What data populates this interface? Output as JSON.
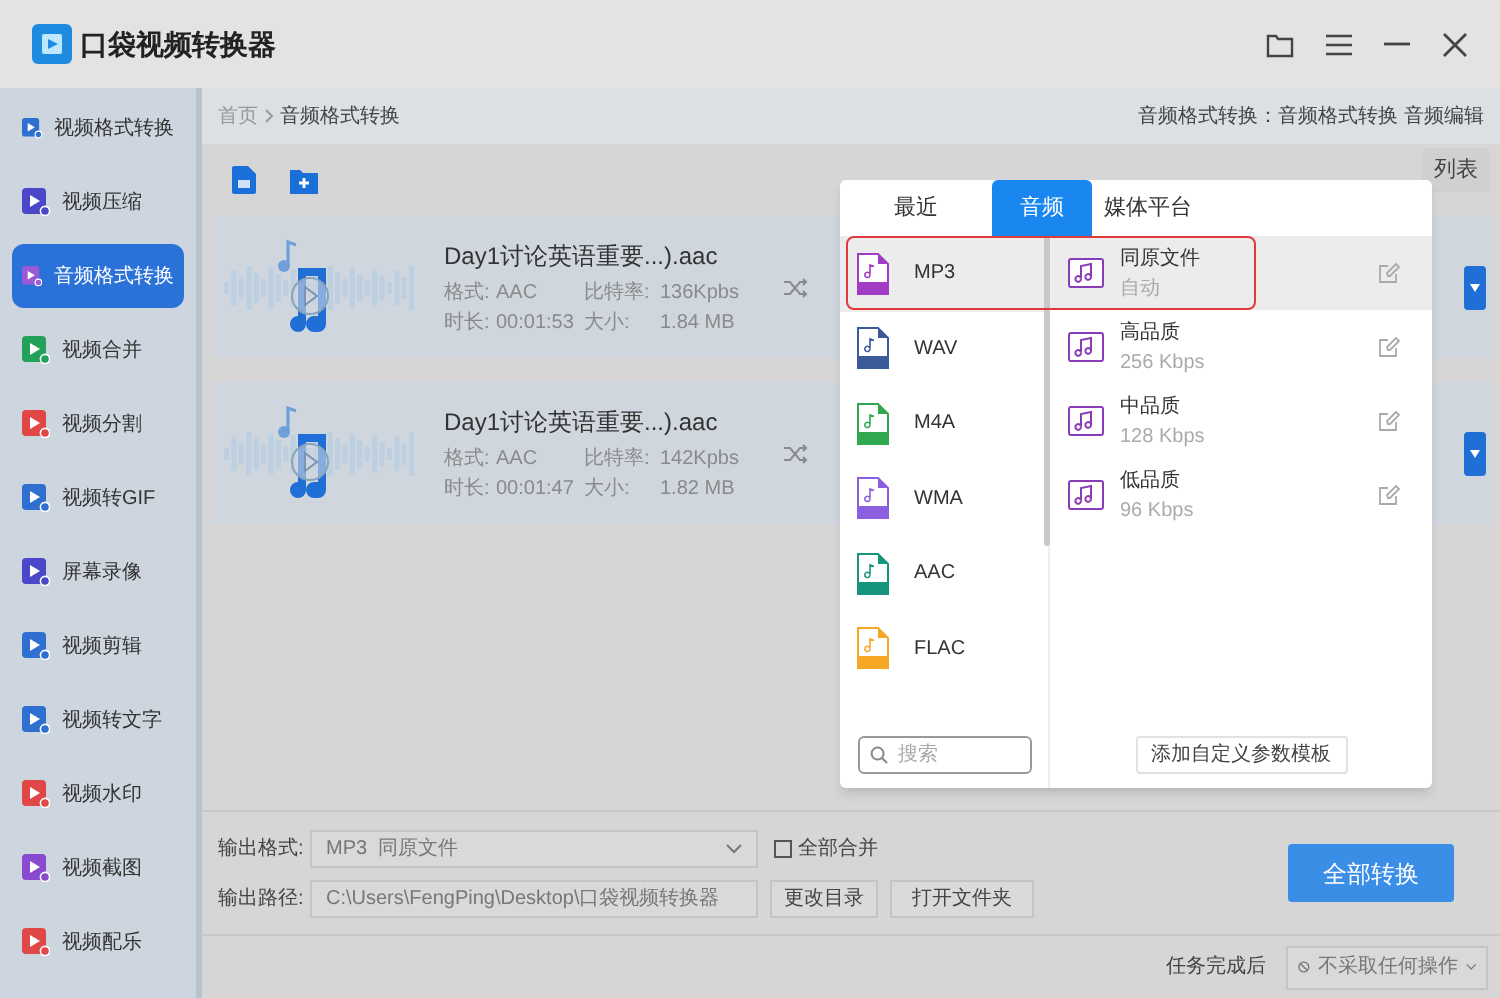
{
  "app": {
    "title": "口袋视频转换器"
  },
  "sidebar": {
    "items": [
      {
        "label": "视频格式转换",
        "color": "#2f6fd0",
        "selected": false
      },
      {
        "label": "视频压缩",
        "color": "#4a48c8",
        "selected": false
      },
      {
        "label": "音频格式转换",
        "color": "#9a5ad8",
        "selected": true
      },
      {
        "label": "视频合并",
        "color": "#23a05a",
        "selected": false
      },
      {
        "label": "视频分割",
        "color": "#e04848",
        "selected": false
      },
      {
        "label": "视频转GIF",
        "color": "#2f6fd0",
        "selected": false
      },
      {
        "label": "屏幕录像",
        "color": "#4a48c8",
        "selected": false
      },
      {
        "label": "视频剪辑",
        "color": "#2f6fd0",
        "selected": false
      },
      {
        "label": "视频转文字",
        "color": "#2f6fd0",
        "selected": false
      },
      {
        "label": "视频水印",
        "color": "#e04848",
        "selected": false
      },
      {
        "label": "视频截图",
        "color": "#8a4ad0",
        "selected": false
      },
      {
        "label": "视频配乐",
        "color": "#e04848",
        "selected": false
      }
    ]
  },
  "breadcrumb": {
    "items": [
      "首页",
      "音频格式转换"
    ],
    "right_text": "音频格式转换：音频格式转换 音频编辑"
  },
  "clear_button": {
    "label": "列表"
  },
  "files": [
    {
      "name": "Day1讨论英语重要...).aac",
      "format_label": "格式:",
      "format": "AAC",
      "bitrate_label": "比特率:",
      "bitrate": "136Kpbs",
      "duration_label": "时长:",
      "duration": "00:01:53",
      "size_label": "大小:",
      "size": "1.84 MB"
    },
    {
      "name": "Day1讨论英语重要...).aac",
      "format_label": "格式:",
      "format": "AAC",
      "bitrate_label": "比特率:",
      "bitrate": "142Kpbs",
      "duration_label": "时长:",
      "duration": "00:01:47",
      "size_label": "大小:",
      "size": "1.82 MB"
    }
  ],
  "format_popup": {
    "tabs": [
      {
        "label": "最近",
        "selected": false
      },
      {
        "label": "音频",
        "selected": true
      },
      {
        "label": "媒体平台",
        "selected": false
      }
    ],
    "formats": [
      {
        "label": "MP3",
        "color": "#a33cc4",
        "selected": true
      },
      {
        "label": "WAV",
        "color": "#3a5a9a",
        "selected": false
      },
      {
        "label": "M4A",
        "color": "#2fa84f",
        "selected": false
      },
      {
        "label": "WMA",
        "color": "#8a5fe0",
        "selected": false
      },
      {
        "label": "AAC",
        "color": "#16957c",
        "selected": false
      },
      {
        "label": "FLAC",
        "color": "#f5a623",
        "selected": false
      }
    ],
    "presets": [
      {
        "title": "同原文件",
        "subtitle": "自动",
        "selected": true
      },
      {
        "title": "高品质",
        "subtitle": "256 Kbps",
        "selected": false
      },
      {
        "title": "中品质",
        "subtitle": "128 Kbps",
        "selected": false
      },
      {
        "title": "低品质",
        "subtitle": "96 Kbps",
        "selected": false
      }
    ],
    "search_placeholder": "搜索",
    "add_template": "添加自定义参数模板"
  },
  "output": {
    "format_label": "输出格式:",
    "format_value": "MP3  同原文件",
    "merge": {
      "label": "全部合并",
      "checked": false
    },
    "path_label": "输出路径:",
    "path": "C:\\Users\\FengPing\\Desktop\\口袋视频转换器",
    "change_dir": "更改目录",
    "open_folder": "打开文件夹",
    "convert_all": "全部转换"
  },
  "status_bar": {
    "label": "任务完成后",
    "action": "不采取任何操作"
  }
}
